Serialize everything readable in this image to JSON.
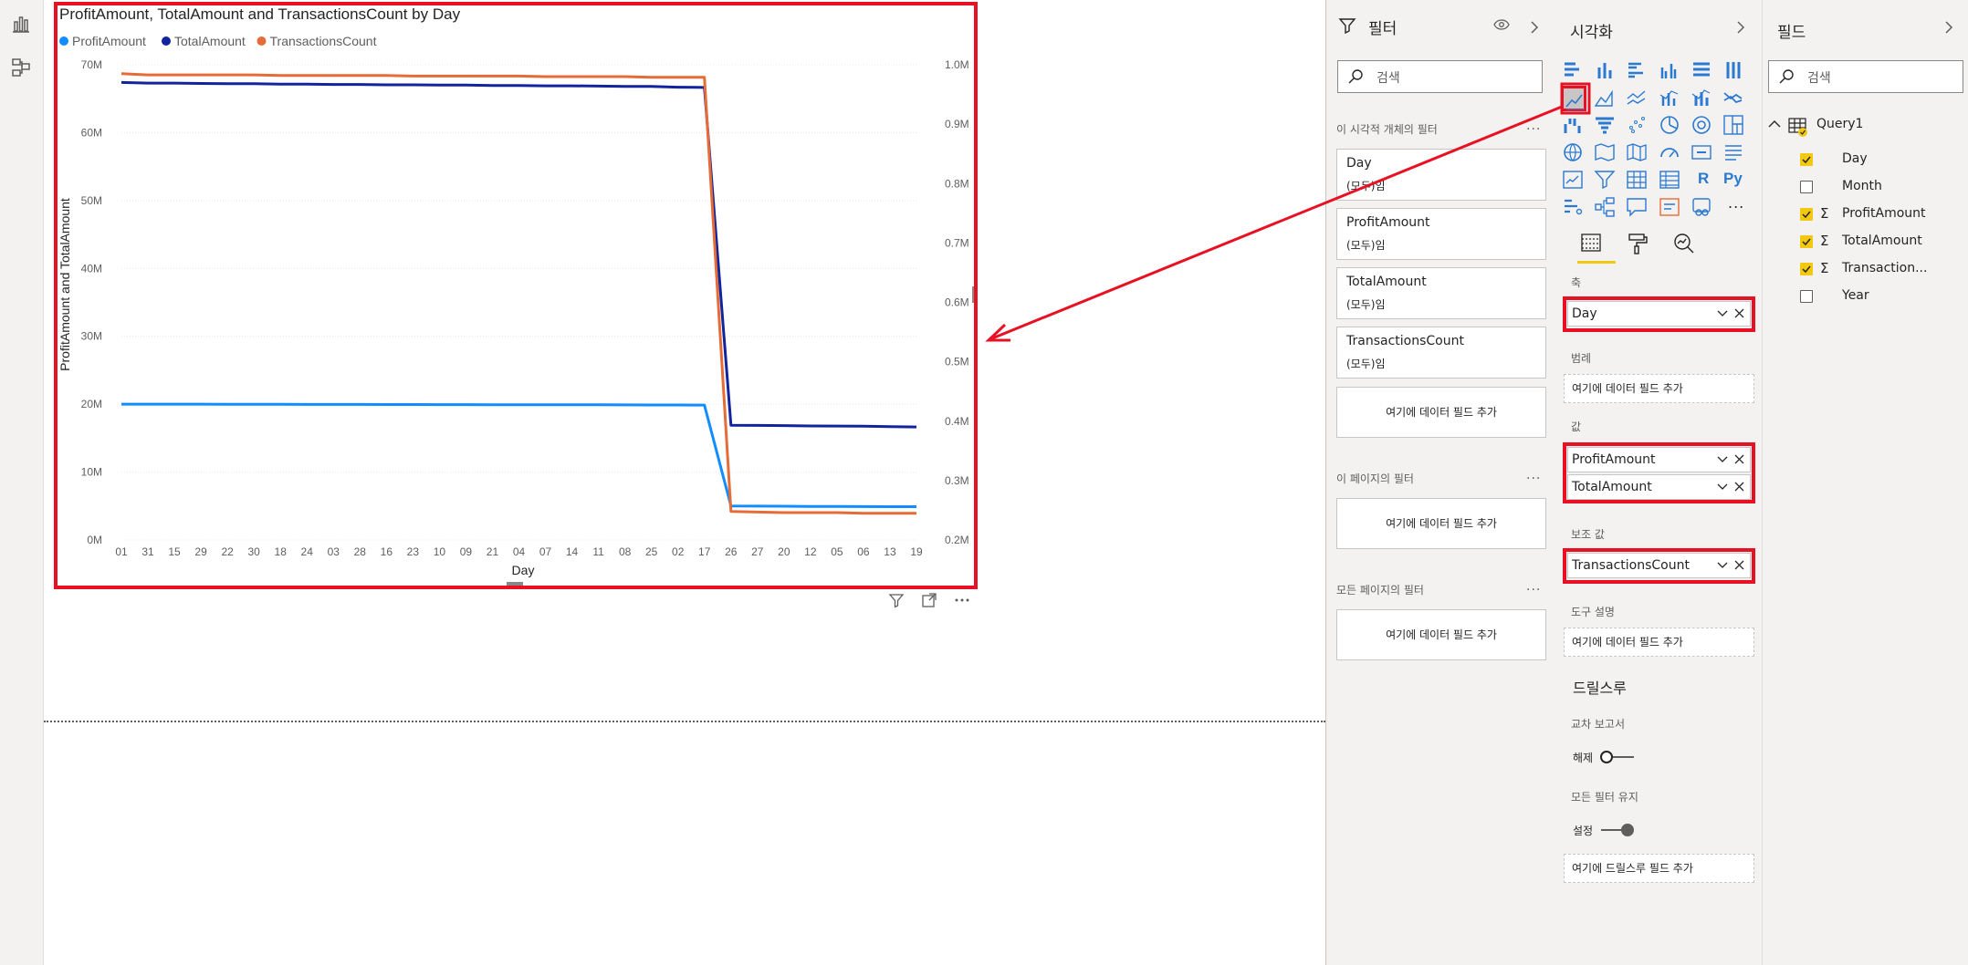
{
  "colors": {
    "accent": "#f2c811",
    "highlight": "#e81123",
    "profit": "#118dff",
    "total": "#12239e",
    "transactions": "#e66c37"
  },
  "chart_data": {
    "type": "line",
    "title": "ProfitAmount, TotalAmount and TransactionsCount by Day",
    "xlabel": "Day",
    "ylabel": "ProfitAmount and TotalAmount",
    "categories": [
      "01",
      "31",
      "15",
      "29",
      "22",
      "30",
      "18",
      "24",
      "03",
      "28",
      "16",
      "23",
      "10",
      "09",
      "21",
      "04",
      "07",
      "14",
      "11",
      "08",
      "25",
      "02",
      "17",
      "26",
      "27",
      "20",
      "12",
      "05",
      "06",
      "13",
      "19"
    ],
    "series": [
      {
        "name": "ProfitAmount",
        "axis": "primary",
        "color": "#118dff",
        "values": [
          20.0,
          20.0,
          20.0,
          20.0,
          19.99,
          19.99,
          19.98,
          19.97,
          19.97,
          19.96,
          19.95,
          19.95,
          19.94,
          19.94,
          19.93,
          19.93,
          19.92,
          19.92,
          19.91,
          19.9,
          19.89,
          19.88,
          19.87,
          5.0,
          4.99,
          4.97,
          4.95,
          4.93,
          4.92,
          4.91,
          4.9
        ]
      },
      {
        "name": "TotalAmount",
        "axis": "primary",
        "color": "#12239e",
        "values": [
          67.4,
          67.3,
          67.3,
          67.25,
          67.2,
          67.2,
          67.15,
          67.15,
          67.1,
          67.1,
          67.05,
          67.05,
          67.0,
          67.0,
          66.95,
          66.95,
          66.9,
          66.9,
          66.85,
          66.8,
          66.8,
          66.7,
          66.65,
          16.9,
          16.88,
          16.85,
          16.8,
          16.78,
          16.75,
          16.7,
          16.65
        ]
      },
      {
        "name": "TransactionsCount",
        "axis": "secondary",
        "color": "#e66c37",
        "values": [
          0.985,
          0.983,
          0.983,
          0.983,
          0.983,
          0.983,
          0.982,
          0.982,
          0.982,
          0.982,
          0.982,
          0.981,
          0.981,
          0.981,
          0.981,
          0.981,
          0.98,
          0.98,
          0.98,
          0.98,
          0.979,
          0.979,
          0.979,
          0.248,
          0.247,
          0.246,
          0.246,
          0.246,
          0.245,
          0.245,
          0.245
        ]
      }
    ],
    "y_axis_primary": {
      "range": [
        0,
        70
      ],
      "ticks": [
        "0M",
        "10M",
        "20M",
        "30M",
        "40M",
        "50M",
        "60M",
        "70M"
      ]
    },
    "y_axis_secondary": {
      "range": [
        0.2,
        1.0
      ],
      "ticks": [
        "0.2M",
        "0.3M",
        "0.4M",
        "0.5M",
        "0.6M",
        "0.7M",
        "0.8M",
        "0.9M",
        "1.0M"
      ]
    },
    "legend_position": "top-left",
    "grid": true
  },
  "filters_pane": {
    "title": "필터",
    "search_placeholder": "검색",
    "visual_section": "이 시각적 개체의 필터",
    "visual_filters": [
      {
        "name": "Day",
        "value": "(모두)임"
      },
      {
        "name": "ProfitAmount",
        "value": "(모두)임"
      },
      {
        "name": "TotalAmount",
        "value": "(모두)임"
      },
      {
        "name": "TransactionsCount",
        "value": "(모두)임"
      }
    ],
    "add_field": "여기에 데이터 필드 추가",
    "page_section": "이 페이지의 필터",
    "all_pages_section": "모든 페이지의 필터",
    "more": "..."
  },
  "viz_pane": {
    "title": "시각화",
    "axis_label": "축",
    "axis_field": "Day",
    "legend_label": "범례",
    "legend_placeholder": "여기에 데이터 필드 추가",
    "values_label": "값",
    "value_fields": [
      "ProfitAmount",
      "TotalAmount"
    ],
    "secondary_label": "보조 값",
    "secondary_field": "TransactionsCount",
    "tooltip_label": "도구 설명",
    "tooltip_placeholder": "여기에 데이터 필드 추가",
    "drillthrough_title": "드릴스루",
    "cross_report_label": "교차 보고서",
    "cross_report_state": "해제",
    "keep_filters_label": "모든 필터 유지",
    "keep_filters_state": "설정",
    "drill_placeholder": "여기에 드릴스루 필드 추가",
    "icon_r": "R",
    "icon_py": "Py",
    "icon_more": "..."
  },
  "fields_pane": {
    "title": "필드",
    "search_placeholder": "검색",
    "table_name": "Query1",
    "fields": [
      {
        "name": "Day",
        "checked": true,
        "sigma": false
      },
      {
        "name": "Month",
        "checked": false,
        "sigma": false
      },
      {
        "name": "ProfitAmount",
        "checked": true,
        "sigma": true
      },
      {
        "name": "TotalAmount",
        "checked": true,
        "sigma": true
      },
      {
        "name": "Transaction...",
        "checked": true,
        "sigma": true
      },
      {
        "name": "Year",
        "checked": false,
        "sigma": false
      }
    ]
  }
}
